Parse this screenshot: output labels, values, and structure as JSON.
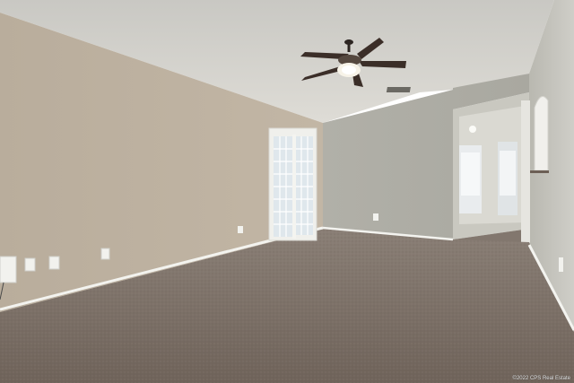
{
  "scene": {
    "description_type": "empty-room-photo",
    "colors": {
      "wall_left": "#b7ab9a",
      "wall_back": "#b3b2a9",
      "wall_right": "#c5c4bd",
      "ceiling": "#d3d2cd",
      "carpet": "#7b6e64",
      "trim": "#f2f2ee",
      "door": "#eeeeea",
      "glass": "#dfe8ee",
      "fan_blade": "#3b2e28"
    },
    "features": [
      "ceiling-fan",
      "french-door",
      "hallway",
      "electrical-outlets",
      "air-vent"
    ]
  },
  "watermark": "©2022 CPS Real Estate"
}
